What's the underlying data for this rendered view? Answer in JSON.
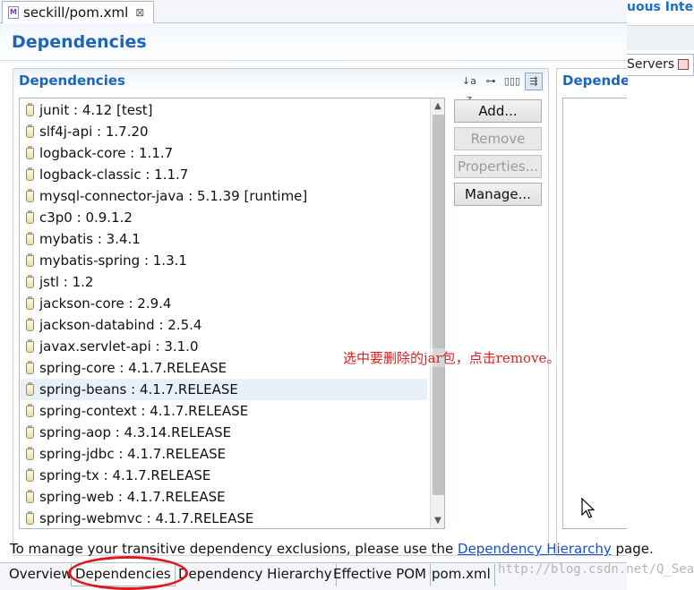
{
  "editor_tab": {
    "icon": "maven-pom-file-icon",
    "title": "seckill/pom.xml",
    "close": "⊠"
  },
  "side_panel": {
    "title_fragment": "uous Integ",
    "servers_tab": "Servers"
  },
  "page": {
    "title": "Dependencies"
  },
  "dependencies_section": {
    "title": "Dependencies",
    "toolbar": [
      {
        "name": "sort-alphabetically-icon",
        "glyph": "↓a z"
      },
      {
        "name": "show-groupid-icon",
        "glyph": "⊶"
      },
      {
        "name": "show-version-icon",
        "glyph": "▯▯▯"
      },
      {
        "name": "filter-icon",
        "glyph": "⇶"
      }
    ],
    "items": [
      {
        "label": "junit : 4.12 [test]"
      },
      {
        "label": "slf4j-api : 1.7.20"
      },
      {
        "label": "logback-core : 1.1.7"
      },
      {
        "label": "logback-classic : 1.1.7"
      },
      {
        "label": "mysql-connector-java : 5.1.39 [runtime]"
      },
      {
        "label": "c3p0 : 0.9.1.2"
      },
      {
        "label": "mybatis : 3.4.1"
      },
      {
        "label": "mybatis-spring : 1.3.1"
      },
      {
        "label": "jstl : 1.2"
      },
      {
        "label": "jackson-core : 2.9.4"
      },
      {
        "label": "jackson-databind : 2.5.4"
      },
      {
        "label": "javax.servlet-api : 3.1.0"
      },
      {
        "label": "spring-core : 4.1.7.RELEASE"
      },
      {
        "label": "spring-beans : 4.1.7.RELEASE",
        "selected": true
      },
      {
        "label": "spring-context : 4.1.7.RELEASE"
      },
      {
        "label": "spring-aop : 4.3.14.RELEASE"
      },
      {
        "label": "spring-jdbc : 4.1.7.RELEASE"
      },
      {
        "label": "spring-tx : 4.1.7.RELEASE"
      },
      {
        "label": "spring-web : 4.1.7.RELEASE"
      },
      {
        "label": "spring-webmvc : 4.1.7.RELEASE"
      }
    ],
    "buttons": {
      "add": "Add...",
      "remove": "Remove",
      "properties": "Properties...",
      "manage": "Manage..."
    }
  },
  "managed_section": {
    "title_fragment": "Dependen"
  },
  "annotation": "选中要删除的jar包，点击remove。",
  "info": {
    "text_before": "To manage your transitive dependency exclusions, please use the ",
    "link": "Dependency Hierarchy",
    "text_after": " page."
  },
  "bottom_tabs": [
    {
      "label": "Overview"
    },
    {
      "label": "Dependencies",
      "active": true
    },
    {
      "label": "Dependency Hierarchy"
    },
    {
      "label": "Effective POM"
    },
    {
      "label": "pom.xml"
    }
  ],
  "watermark": "http://blog.csdn.net/Q_Sea__"
}
